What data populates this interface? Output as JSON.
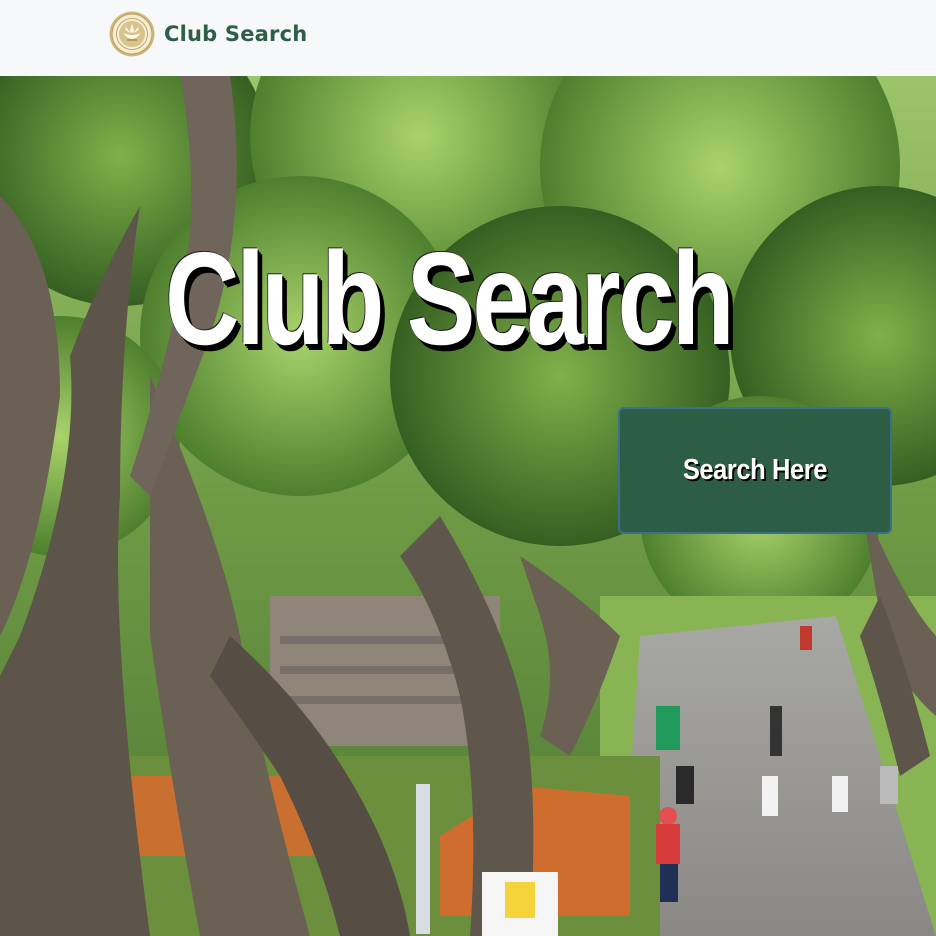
{
  "navbar": {
    "brand_label": "Club Search",
    "logo_icon": "university-seal-icon"
  },
  "hero": {
    "title": "Club Search",
    "search_button_label": "Search Here",
    "background_image": "campus-trees-walkway-photo"
  },
  "colors": {
    "brand_green": "#2f5e47",
    "button_green": "#2d5e45",
    "button_border": "#3a6f8f",
    "navbar_bg": "#f7f8f9"
  }
}
